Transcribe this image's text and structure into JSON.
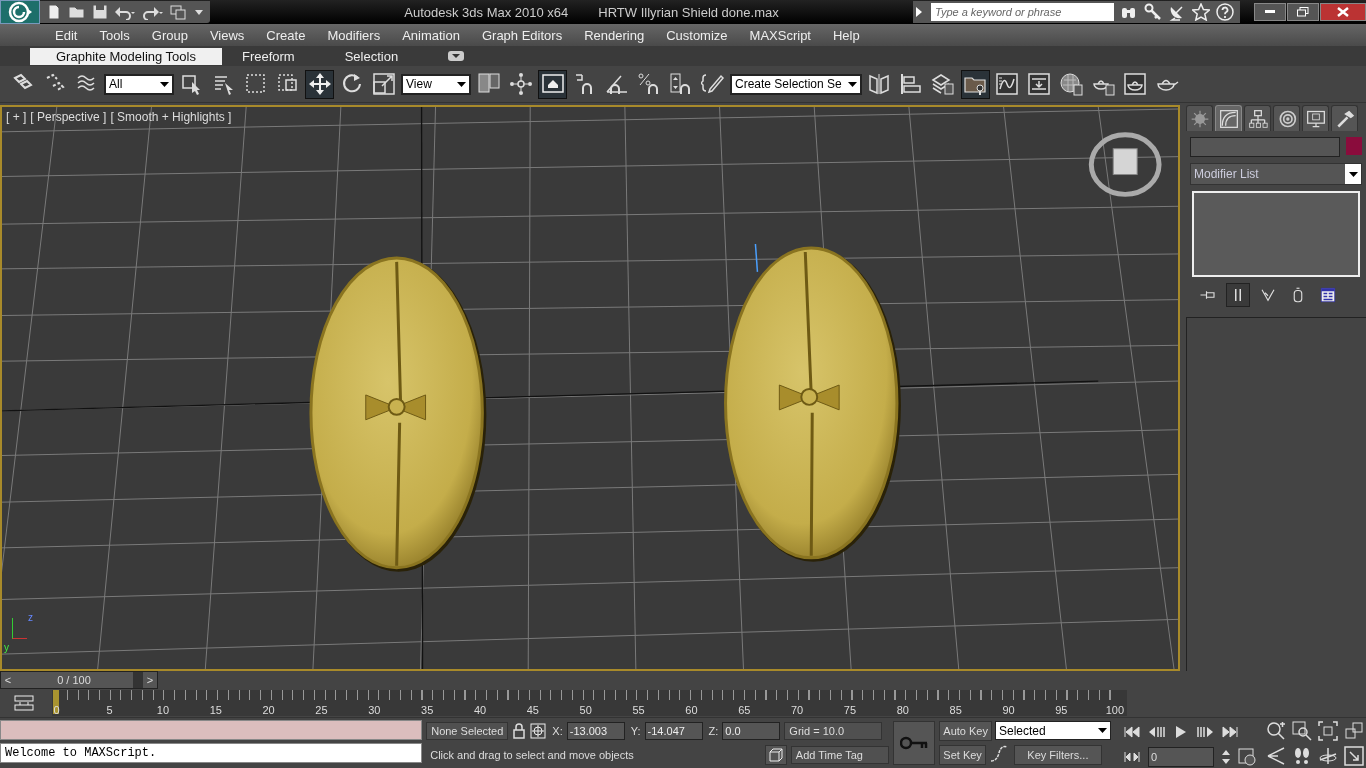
{
  "title_bar": {
    "app_title": "Autodesk 3ds Max  2010 x64",
    "file_name": "HRTW Illyrian Shield done.max",
    "search": {
      "placeholder": "Type a keyword or phrase"
    }
  },
  "menu_bar": [
    "Edit",
    "Tools",
    "Group",
    "Views",
    "Create",
    "Modifiers",
    "Animation",
    "Graph Editors",
    "Rendering",
    "Customize",
    "MAXScript",
    "Help"
  ],
  "ribbon_tabs": [
    {
      "label": "Graphite Modeling Tools",
      "selected": true
    },
    {
      "label": "Freeform",
      "selected": false
    },
    {
      "label": "Selection",
      "selected": false
    }
  ],
  "main_toolbar": [
    {
      "kind": "link",
      "selected": false
    },
    {
      "kind": "unlink",
      "selected": false
    },
    {
      "kind": "bind",
      "selected": false
    },
    {
      "kind": "dropdown",
      "value": "All"
    },
    {
      "kind": "select",
      "selected": false
    },
    {
      "kind": "select-by-name",
      "selected": false
    },
    {
      "kind": "region",
      "selected": false
    },
    {
      "kind": "crossing",
      "selected": false
    },
    {
      "kind": "move",
      "selected": true
    },
    {
      "kind": "rotate",
      "selected": false
    },
    {
      "kind": "scale",
      "selected": false
    },
    {
      "kind": "dropdown",
      "value": "View"
    },
    {
      "kind": "pivot",
      "selected": false
    },
    {
      "kind": "manipulate",
      "selected": false
    },
    {
      "kind": "keyboard",
      "selected": true
    },
    {
      "kind": "snap",
      "selected": false
    },
    {
      "kind": "angle-snap",
      "selected": false
    },
    {
      "kind": "percent-snap",
      "selected": false
    },
    {
      "kind": "spinner-snap",
      "selected": false
    },
    {
      "kind": "edit-named",
      "selected": false
    },
    {
      "kind": "dropdown",
      "value": "Create Selection Se"
    },
    {
      "kind": "mirror",
      "selected": false
    },
    {
      "kind": "align",
      "selected": false
    },
    {
      "kind": "layers",
      "selected": false
    },
    {
      "kind": "explorer",
      "selected": true
    },
    {
      "kind": "curve",
      "selected": false
    },
    {
      "kind": "schematic",
      "selected": false
    },
    {
      "kind": "material",
      "selected": false
    },
    {
      "kind": "render-setup",
      "selected": false
    },
    {
      "kind": "frame-window",
      "selected": false
    },
    {
      "kind": "render",
      "selected": false
    }
  ],
  "viewport": {
    "labels": [
      "[ + ]",
      "[ Perspective ]",
      "[ Smooth + Highlights ]"
    ],
    "axis_labels": [
      "z",
      "y"
    ]
  },
  "command_panel": {
    "tabs": [
      {
        "kind": "create",
        "selected": false
      },
      {
        "kind": "modify",
        "selected": true
      },
      {
        "kind": "hierarchy",
        "selected": false
      },
      {
        "kind": "motion",
        "selected": false
      },
      {
        "kind": "display",
        "selected": false
      },
      {
        "kind": "utilities",
        "selected": false
      }
    ],
    "object": {
      "color": "#8a0c3c"
    },
    "modifier_list": "Modifier List",
    "stack_buttons": [
      {
        "kind": "pin",
        "selected": false
      },
      {
        "kind": "end-result",
        "selected": true
      },
      {
        "kind": "unique",
        "selected": false
      },
      {
        "kind": "remove",
        "selected": false
      },
      {
        "kind": "configure",
        "selected": false
      }
    ]
  },
  "time_slider": {
    "prev": "<",
    "position": "0 / 100",
    "next": ">"
  },
  "track_bar": {
    "ticks": [
      "0",
      "5",
      "10",
      "15",
      "20",
      "25",
      "30",
      "35",
      "40",
      "45",
      "50",
      "55",
      "60",
      "65",
      "70",
      "75",
      "80",
      "85",
      "90",
      "95",
      "100"
    ]
  },
  "status_bar": {
    "listener_output": "Welcome to MAXScript.",
    "selection": "None Selected",
    "coordinates": [
      {
        "label": "X:",
        "value": "-13.003"
      },
      {
        "label": "Y:",
        "value": "-14.047"
      },
      {
        "label": "Z:",
        "value": "0.0"
      }
    ],
    "grid": "Grid = 10.0",
    "prompt": "Click and drag to select and move objects",
    "time_tag": "Add Time Tag",
    "auto_key": "Auto Key",
    "set_key": "Set Key",
    "key_mode": "Selected",
    "key_filters": "Key Filters...",
    "frame": "0"
  }
}
